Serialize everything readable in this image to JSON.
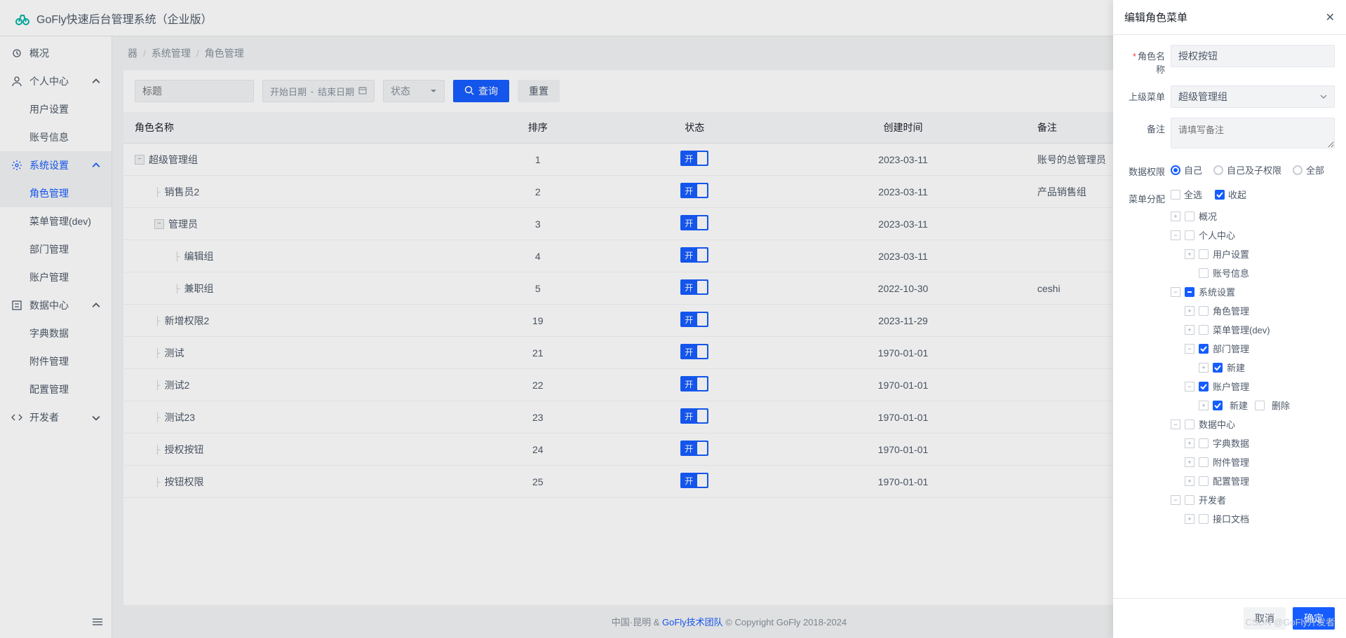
{
  "header": {
    "title": "GoFly快速后台管理系统（企业版）"
  },
  "sidebar": {
    "items": [
      {
        "label": "概况",
        "icon": "home"
      },
      {
        "label": "个人中心",
        "icon": "user",
        "expandable": true,
        "children": [
          {
            "label": "用户设置"
          },
          {
            "label": "账号信息"
          }
        ]
      },
      {
        "label": "系统设置",
        "icon": "gear",
        "expandable": true,
        "active": true,
        "children": [
          {
            "label": "角色管理",
            "active": true
          },
          {
            "label": "菜单管理(dev)"
          },
          {
            "label": "部门管理"
          },
          {
            "label": "账户管理"
          }
        ]
      },
      {
        "label": "数据中心",
        "icon": "list",
        "expandable": true,
        "children": [
          {
            "label": "字典数据"
          },
          {
            "label": "附件管理"
          },
          {
            "label": "配置管理"
          }
        ]
      },
      {
        "label": "开发者",
        "icon": "code",
        "expandable": true
      }
    ]
  },
  "breadcrumb": {
    "icon": "器",
    "items": [
      "系统管理",
      "角色管理"
    ]
  },
  "toolbar": {
    "title_placeholder": "标题",
    "start_date": "开始日期",
    "end_date": "结束日期",
    "status": "状态",
    "search": "查询",
    "reset": "重置"
  },
  "table": {
    "columns": [
      "角色名称",
      "排序",
      "状态",
      "创建时间",
      "备注"
    ],
    "switch_on": "开",
    "rows": [
      {
        "indent": 0,
        "toggle": "−",
        "name": "超级管理组",
        "sort": "1",
        "date": "2023-03-11",
        "note": "账号的总管理员"
      },
      {
        "indent": 1,
        "toggle": "",
        "name": "销售员2",
        "sort": "2",
        "date": "2023-03-11",
        "note": "产品销售组"
      },
      {
        "indent": 1,
        "toggle": "−",
        "name": "管理员",
        "sort": "3",
        "date": "2023-03-11",
        "note": ""
      },
      {
        "indent": 2,
        "toggle": "",
        "name": "编辑组",
        "sort": "4",
        "date": "2023-03-11",
        "note": ""
      },
      {
        "indent": 2,
        "toggle": "",
        "name": "兼职组",
        "sort": "5",
        "date": "2022-10-30",
        "note": "ceshi"
      },
      {
        "indent": 1,
        "toggle": "",
        "name": "新增权限2",
        "sort": "19",
        "date": "2023-11-29",
        "note": ""
      },
      {
        "indent": 1,
        "toggle": "",
        "name": "测试",
        "sort": "21",
        "date": "1970-01-01",
        "note": ""
      },
      {
        "indent": 1,
        "toggle": "",
        "name": "测试2",
        "sort": "22",
        "date": "1970-01-01",
        "note": ""
      },
      {
        "indent": 1,
        "toggle": "",
        "name": "测试23",
        "sort": "23",
        "date": "1970-01-01",
        "note": ""
      },
      {
        "indent": 1,
        "toggle": "",
        "name": "授权按钮",
        "sort": "24",
        "date": "1970-01-01",
        "note": ""
      },
      {
        "indent": 1,
        "toggle": "",
        "name": "按钮权限",
        "sort": "25",
        "date": "1970-01-01",
        "note": ""
      }
    ]
  },
  "footer": {
    "left": "中国·昆明 & ",
    "link": "GoFly技术团队",
    "right": " © Copyright GoFly 2018-2024"
  },
  "watermark": "CSDN @GoFly开发者",
  "drawer": {
    "title": "编辑角色菜单",
    "labels": {
      "role_name": "角色名称",
      "parent": "上级菜单",
      "note": "备注",
      "data_perm": "数据权限",
      "menu_assign": "菜单分配"
    },
    "role_name": "授权按钮",
    "parent_menu": "超级管理组",
    "note_placeholder": "请填写备注",
    "perm_options": [
      "自己",
      "自己及子权限",
      "全部"
    ],
    "select_all": "全选",
    "collapse": "收起",
    "tree": [
      {
        "label": "概况",
        "expand": "+",
        "checked": false
      },
      {
        "label": "个人中心",
        "expand": "−",
        "checked": false,
        "children": [
          {
            "label": "用户设置",
            "expand": "+",
            "checked": false
          },
          {
            "label": "账号信息",
            "expand": "",
            "checked": false
          }
        ]
      },
      {
        "label": "系统设置",
        "expand": "−",
        "checked": "ind",
        "children": [
          {
            "label": "角色管理",
            "expand": "+",
            "checked": false
          },
          {
            "label": "菜单管理(dev)",
            "expand": "+",
            "checked": false
          },
          {
            "label": "部门管理",
            "expand": "−",
            "checked": true,
            "children": [
              {
                "label": "新建",
                "expand": "+",
                "checked": true
              }
            ]
          },
          {
            "label": "账户管理",
            "expand": "−",
            "checked": true,
            "children": [
              {
                "inline": [
                  {
                    "label": "新建",
                    "checked": true
                  },
                  {
                    "label": "删除",
                    "checked": false
                  }
                ],
                "expand": "+"
              }
            ]
          }
        ]
      },
      {
        "label": "数据中心",
        "expand": "−",
        "checked": false,
        "children": [
          {
            "label": "字典数据",
            "expand": "+",
            "checked": false
          },
          {
            "label": "附件管理",
            "expand": "+",
            "checked": false
          },
          {
            "label": "配置管理",
            "expand": "+",
            "checked": false
          }
        ]
      },
      {
        "label": "开发者",
        "expand": "−",
        "checked": false,
        "children": [
          {
            "label": "接口文档",
            "expand": "+",
            "checked": false
          }
        ]
      }
    ],
    "cancel": "取消",
    "confirm": "确定"
  }
}
